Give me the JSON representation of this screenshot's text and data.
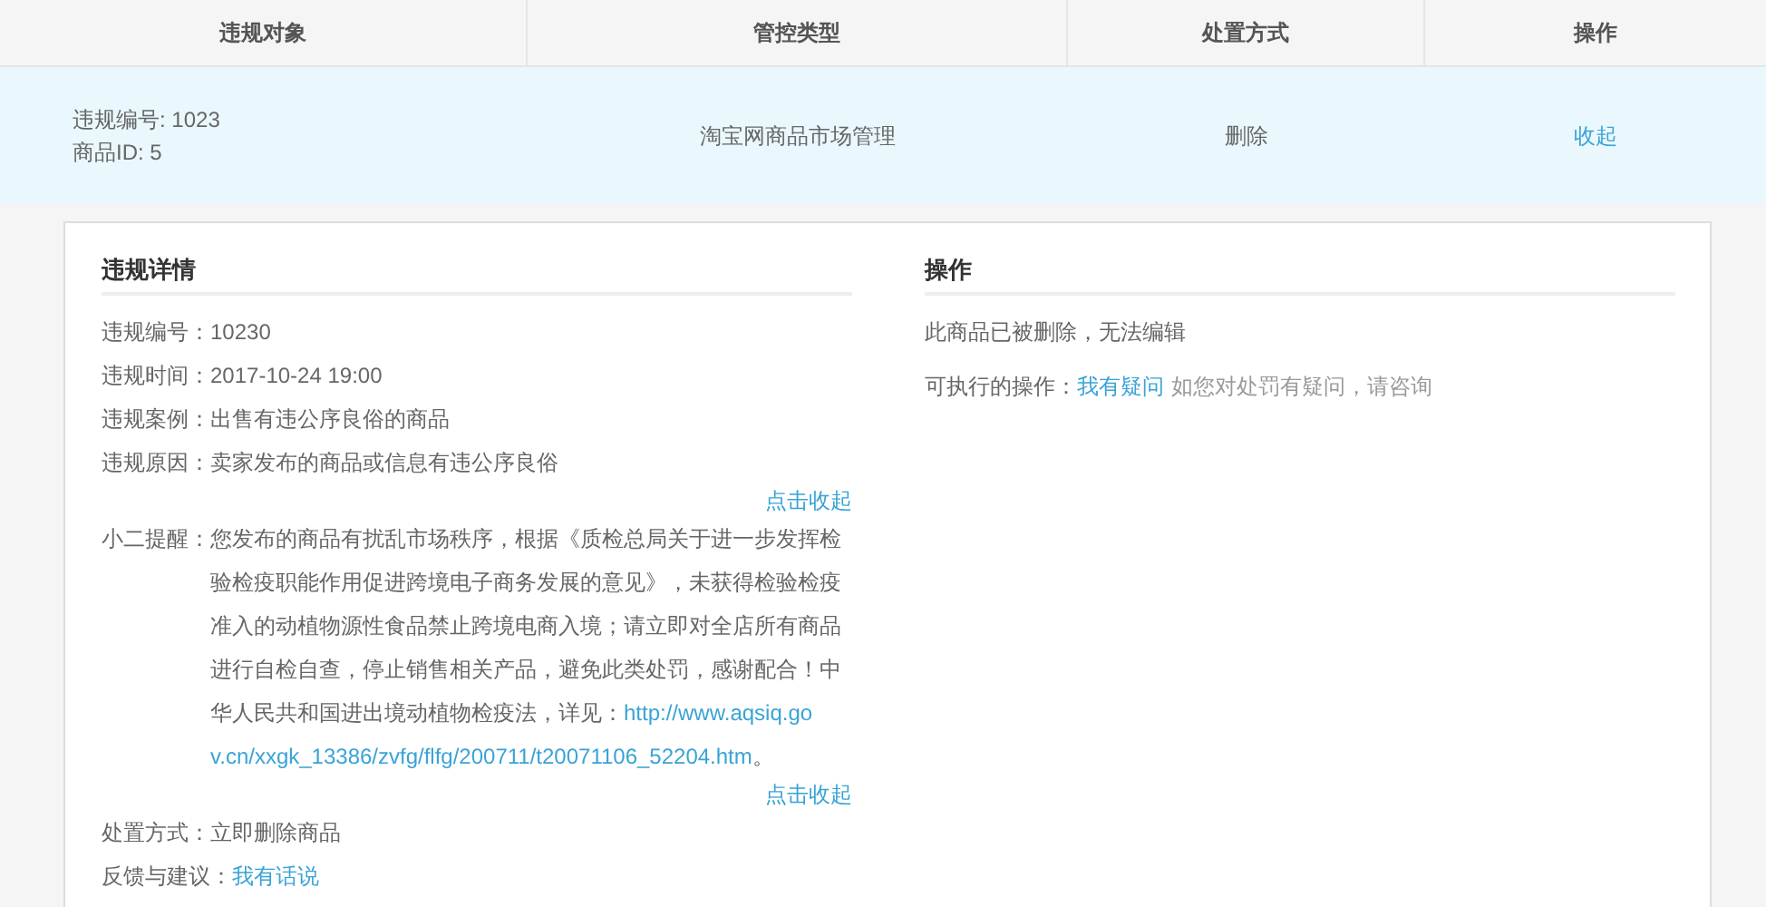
{
  "table": {
    "columns": [
      "违规对象",
      "管控类型",
      "处置方式",
      "操作"
    ],
    "rows": [
      {
        "object_lines": [
          "违规编号: 1023",
          "商品ID: 5"
        ],
        "control_type": "淘宝网商品市场管理",
        "action_method": "删除",
        "operation": "收起",
        "selected": true
      }
    ]
  },
  "details": {
    "title": "违规详情",
    "items": [
      {
        "kind": "field",
        "label": "违规编号：",
        "value": "10230"
      },
      {
        "kind": "field",
        "label": "违规时间：",
        "value": "2017-10-24 19:00"
      },
      {
        "kind": "field",
        "label": "违规案例：",
        "value": "出售有违公序良俗的商品"
      },
      {
        "kind": "field",
        "label": "违规原因：",
        "value": "卖家发布的商品或信息有违公序良俗"
      },
      {
        "kind": "collapse",
        "text": "点击收起"
      },
      {
        "kind": "note",
        "label": "小二提醒：",
        "value": "您发布的商品有扰乱市场秩序，根据《质检总局关于进一步发挥检验检疫职能作用促进跨境电子商务发展的意见》，未获得检验检疫准入的动植物源性食品禁止跨境电商入境；请立即对全店所有商品进行自检自查，停止销售相关产品，避免此类处罚，感谢配合！中华人民共和国进出境动植物检疫法，详见：",
        "link_lines": [
          "http://www.aqsiq.go",
          "v.cn/xxgk_13386/zvfg/flfg/200711/t20071106_52204.htm"
        ],
        "after": "。"
      },
      {
        "kind": "collapse",
        "text": "点击收起"
      },
      {
        "kind": "field",
        "label": "处置方式：",
        "value": "立即删除商品"
      },
      {
        "kind": "linkfield",
        "label": "反馈与建议：",
        "value": "我有话说"
      }
    ]
  },
  "operations": {
    "title": "操作",
    "status": "此商品已被删除，无法编辑",
    "available_label": "可执行的操作：",
    "link": "我有疑问",
    "hint": "如您对处罚有疑问，请咨询"
  }
}
